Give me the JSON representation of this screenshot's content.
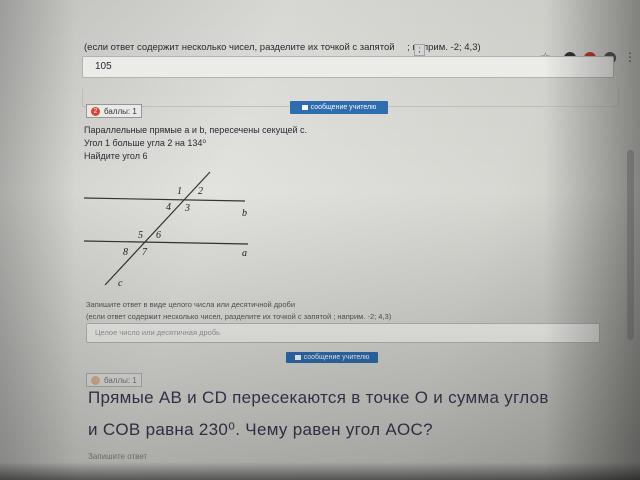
{
  "top": {
    "instruction": "(если ответ содержит несколько чисел, разделите их точкой с запятой",
    "instruction_tail": ";  наприм. -2; 4,3)",
    "answer_value": "105"
  },
  "task2": {
    "badge_number": "2",
    "badge_label": "баллы: 1",
    "message_button": "сообщение учителю",
    "line1": "Параллельные прямые a и b, пересечены секущей c.",
    "line2": "Угол 1 больше угла 2 на 134⁰",
    "line3": "Найдите угол 6",
    "figure": {
      "labels": {
        "a1": "1",
        "a2": "2",
        "a3": "3",
        "a4": "4",
        "a5": "5",
        "a6": "6",
        "a7": "7",
        "a8": "8",
        "b": "b",
        "a": "a",
        "c": "c"
      }
    },
    "note1": "Запишите ответ в виде целого числа или десятичной дроби",
    "note2": "(если ответ содержит несколько чисел, разделите их точкой с запятой  ;  наприм. -2; 4,3)",
    "input_placeholder": "Целое число или десятичная дробь",
    "submit_button": "сообщение учителю"
  },
  "task3": {
    "badge_label": "баллы: 1",
    "line1": "Прямые  AB  и  CD  пересекаются в точке  O  и сумма углов",
    "line2": "и  COB  равна  230⁰. Чему равен угол  AOC?",
    "note": "Запишите ответ"
  },
  "colors": {
    "accent": "#2f6fb3",
    "badge_red": "#d9472b",
    "text": "#2b2b33"
  }
}
